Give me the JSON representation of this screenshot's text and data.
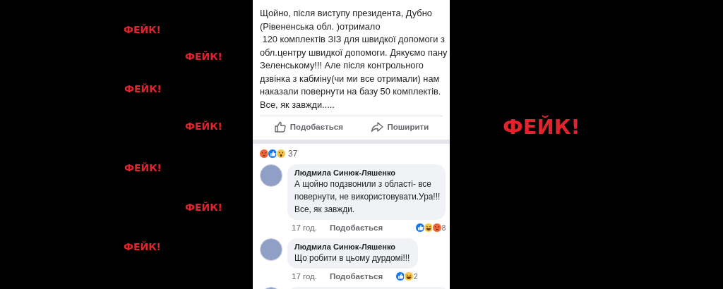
{
  "stamps": [
    {
      "text": "ФЕЙК!",
      "kind": "small"
    },
    {
      "text": "ФЕЙК!",
      "kind": "small"
    },
    {
      "text": "ФЕЙК!",
      "kind": "small"
    },
    {
      "text": "ФЕЙК!",
      "kind": "small"
    },
    {
      "text": "ФЕЙК!",
      "kind": "small"
    },
    {
      "text": "ФЕЙК!",
      "kind": "small"
    },
    {
      "text": "ФЕЙК!",
      "kind": "small"
    },
    {
      "text": "ФЕЙК!",
      "kind": "large"
    }
  ],
  "post": {
    "text": "Щойно, після виступу президента, Дубно\n(Рівененська обл. )отримало\n 120 комплектів ЗІЗ для швидкої допомоги з\nобл.центру швидкої допомоги. Дякуємо пану\nЗеленському!!! Але після контрольного\nдзвінка з кабміну(чи ми все отримали) нам\nнаказали повернути на базу 50 комплектів.\nВсе, як завжди.....",
    "actions": [
      {
        "kind": "like",
        "label": "Подобається"
      },
      {
        "kind": "share",
        "label": "Поширити"
      }
    ],
    "reactions": {
      "types": [
        {
          "kind": "angry"
        },
        {
          "kind": "like"
        },
        {
          "kind": "wow"
        }
      ],
      "count": "37"
    }
  },
  "comments": [
    {
      "author": "Людмила Синюк-Ляшенко",
      "text": "А щойно подзвонили з області- все\nповернути, не використовувати.Ура!!!\nВсе, як завжди.",
      "time": "17 год.",
      "like_label": "Подобається",
      "reactions": [
        {
          "kind": "like"
        },
        {
          "kind": "haha"
        },
        {
          "kind": "angry"
        }
      ],
      "count": "8"
    },
    {
      "author": "Людмила Синюк-Ляшенко",
      "text": "Що робити в цьому дурдомі!!!",
      "time": "17 год.",
      "like_label": "Подобається",
      "reactions": [
        {
          "kind": "like"
        },
        {
          "kind": "haha"
        }
      ],
      "count": "2"
    }
  ]
}
